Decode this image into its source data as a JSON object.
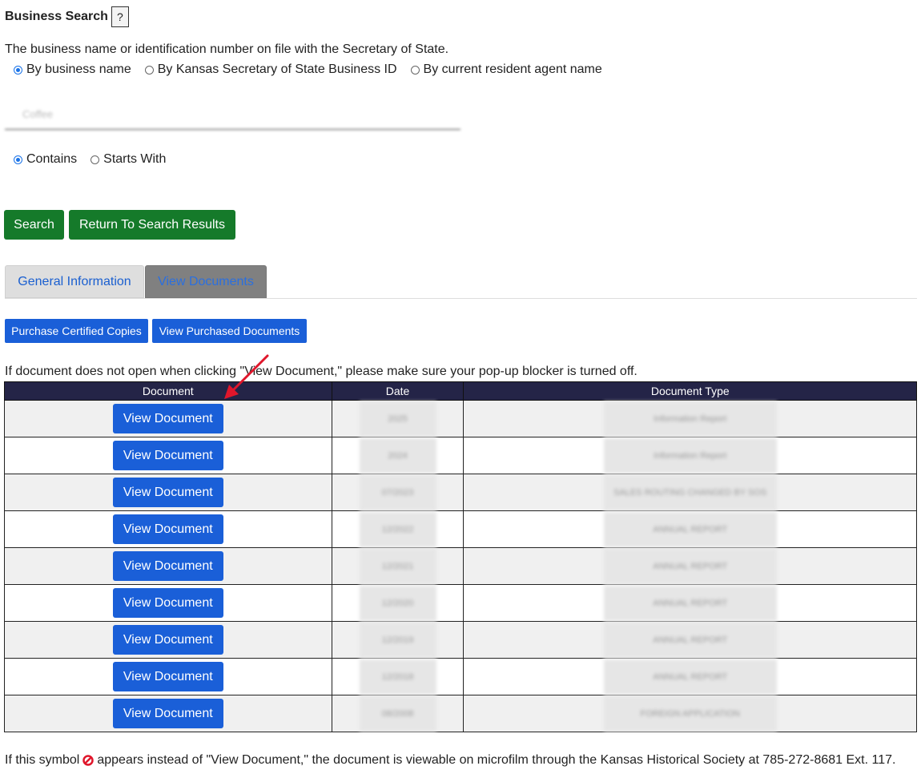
{
  "header": {
    "title": "Business Search",
    "help_label": "?"
  },
  "description": "The business name or identification number on file with the Secretary of State.",
  "search_by": {
    "options": [
      {
        "label": "By business name",
        "checked": true
      },
      {
        "label": "By Kansas Secretary of State Business ID",
        "checked": false
      },
      {
        "label": "By current resident agent name",
        "checked": false
      }
    ]
  },
  "search_input": {
    "value": "Coffee"
  },
  "match_mode": {
    "options": [
      {
        "label": "Contains",
        "checked": true
      },
      {
        "label": "Starts With",
        "checked": false
      }
    ]
  },
  "buttons": {
    "search": "Search",
    "return": "Return To Search Results"
  },
  "tabs": [
    {
      "label": "General Information",
      "active": false
    },
    {
      "label": "View Documents",
      "active": true
    }
  ],
  "document_actions": {
    "purchase": "Purchase Certified Copies",
    "view_purchased": "View Purchased Documents"
  },
  "popup_note": "If document does not open when clicking \"View Document,\" please make sure your pop-up blocker is turned off.",
  "table": {
    "headers": [
      "Document",
      "Date",
      "Document Type"
    ],
    "button_label": "View Document",
    "rows": [
      {
        "date": "2025",
        "type": "Information Report"
      },
      {
        "date": "2024",
        "type": "Information Report"
      },
      {
        "date": "07/2023",
        "type": "SALES ROUTING CHANGED BY SOS"
      },
      {
        "date": "12/2022",
        "type": "ANNUAL REPORT"
      },
      {
        "date": "12/2021",
        "type": "ANNUAL REPORT"
      },
      {
        "date": "12/2020",
        "type": "ANNUAL REPORT"
      },
      {
        "date": "12/2019",
        "type": "ANNUAL REPORT"
      },
      {
        "date": "12/2018",
        "type": "ANNUAL REPORT"
      },
      {
        "date": "08/2008",
        "type": "FOREIGN APPLICATION"
      }
    ]
  },
  "footer": {
    "before": "If this symbol",
    "after": "appears instead of \"View Document,\" the document is viewable on microfilm through the Kansas Historical Society at 785-272-8681 Ext. 117."
  },
  "colors": {
    "green": "#157a2a",
    "blue": "#1a5fd8",
    "table_header": "#242447",
    "arrow": "#e0162b"
  }
}
